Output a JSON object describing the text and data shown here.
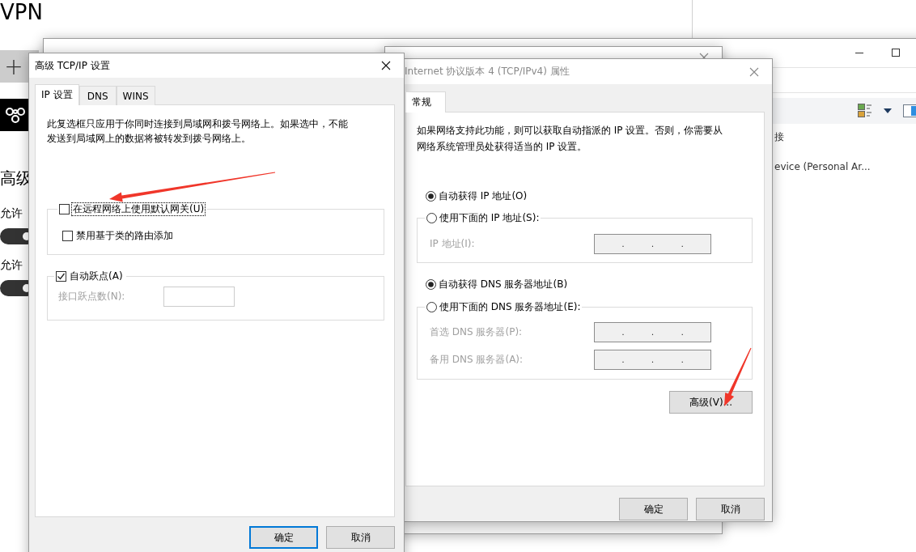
{
  "settings_window": {
    "title": "VPN",
    "add_button": "+",
    "heading": "高级",
    "options": [
      {
        "label": "允许",
        "on": true
      },
      {
        "label": "允许",
        "on": true
      }
    ]
  },
  "network_window": {
    "items": [
      {
        "label": "接"
      },
      {
        "label": "evice (Personal Ar..."
      }
    ]
  },
  "ipv4_dialog": {
    "title": "Internet 协议版本 4 (TCP/IPv4) 属性",
    "active": false,
    "tabs": [
      {
        "label": "常规",
        "selected": true
      }
    ],
    "description": [
      "如果网络支持此功能，则可以获取自动指派的 IP 设置。否则，你需要从",
      "网络系统管理员处获得适当的 IP 设置。"
    ],
    "ip_choice": [
      {
        "label": "自动获得 IP 地址(O)",
        "selected": true
      },
      {
        "label": "使用下面的 IP 地址(S):",
        "selected": false
      }
    ],
    "ip_fields": [
      {
        "label": "IP 地址(I):",
        "disabled": true,
        "separators": [
          ".",
          ".",
          "."
        ]
      }
    ],
    "dns_choice": [
      {
        "label": "自动获得 DNS 服务器地址(B)",
        "selected": true
      },
      {
        "label": "使用下面的 DNS 服务器地址(E):",
        "selected": false
      }
    ],
    "dns_fields": [
      {
        "label": "首选 DNS 服务器(P):",
        "disabled": true,
        "separators": [
          ".",
          ".",
          "."
        ]
      },
      {
        "label": "备用 DNS 服务器(A):",
        "disabled": true,
        "separators": [
          ".",
          ".",
          "."
        ]
      }
    ],
    "advanced_button": "高级(V)...",
    "buttons": [
      {
        "label": "确定",
        "default": false
      },
      {
        "label": "取消",
        "default": false
      }
    ]
  },
  "advanced_dialog": {
    "title": "高级 TCP/IP 设置",
    "active": true,
    "tabs": [
      {
        "label": "IP 设置",
        "selected": true
      },
      {
        "label": "DNS",
        "selected": false
      },
      {
        "label": "WINS",
        "selected": false
      }
    ],
    "description": [
      "此复选框只应用于你同时连接到局域网和拨号网络上。如果选中，不能",
      "发送到局域网上的数据将被转发到拨号网络上。"
    ],
    "gateway_group": {
      "checkbox": {
        "label": "在远程网络上使用默认网关(U)",
        "checked": false,
        "focused": true
      },
      "options": [
        {
          "label": "禁用基于类的路由添加",
          "checked": false
        }
      ]
    },
    "metric_group": {
      "checkbox": {
        "label": "自动跃点(A)",
        "checked": true
      },
      "field": {
        "label": "接口跃点数(N):",
        "disabled": true
      }
    },
    "buttons": [
      {
        "label": "确定",
        "default": true
      },
      {
        "label": "取消",
        "default": false
      }
    ]
  },
  "annotations": [
    {
      "kind": "arrow"
    },
    {
      "kind": "arrow"
    }
  ]
}
